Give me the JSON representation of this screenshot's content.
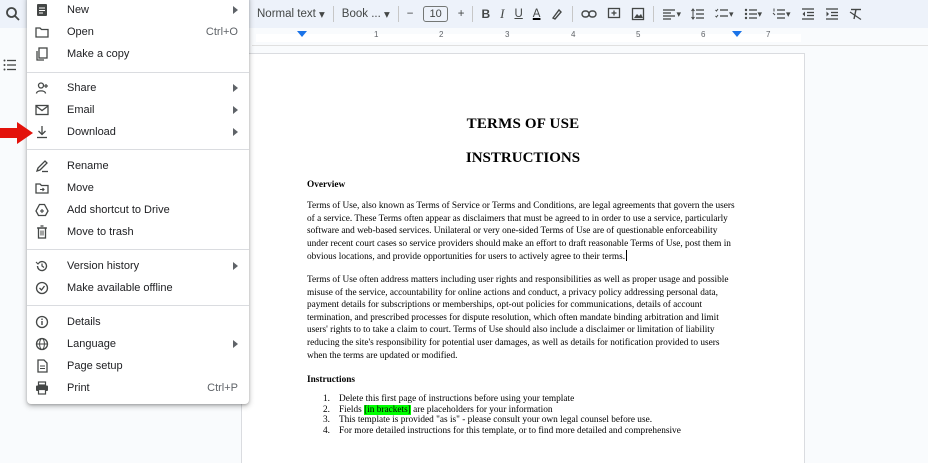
{
  "toolbar": {
    "style": "Normal text",
    "font": "Book ...",
    "minus": "−",
    "size": "10",
    "plus": "+",
    "bold": "B",
    "italic": "I",
    "underline": "U",
    "textcolor": "A"
  },
  "ruler": {
    "numbers": [
      "1",
      "2",
      "3",
      "4",
      "5",
      "6",
      "7"
    ]
  },
  "menu": {
    "new": "New",
    "open": "Open",
    "open_shortcut": "Ctrl+O",
    "copy": "Make a copy",
    "share": "Share",
    "email": "Email",
    "download": "Download",
    "rename": "Rename",
    "move": "Move",
    "shortcut": "Add shortcut to Drive",
    "trash": "Move to trash",
    "version": "Version history",
    "offline": "Make available offline",
    "details": "Details",
    "language": "Language",
    "pagesetup": "Page setup",
    "print": "Print",
    "print_shortcut": "Ctrl+P"
  },
  "doc": {
    "title": "TERMS OF USE",
    "subtitle": "INSTRUCTIONS",
    "overview": "Overview",
    "p1": "Terms of Use, also known as Terms of Service or Terms and Conditions, are legal agreements that govern the users of a service. These Terms often appear as disclaimers that must be agreed to in order to use a service, particularly software and web-based services. Unilateral or very one-sided Terms of Use are of questionable enforceability under recent court cases so service providers should make an effort to draft reasonable Terms of Use, post them in obvious locations, and provide opportunities for users to actively agree to their terms.",
    "p2": "Terms of Use often address matters including user rights and responsibilities as well as proper usage and possible misuse of the service, accountability for online actions and conduct, a privacy policy addressing personal data, payment details for subscriptions or memberships, opt-out policies for communications, details of account termination, and prescribed processes for dispute resolution, which often mandate binding arbitration and limit users' rights to to take a claim to court. Terms of Use should also include a disclaimer or limitation of liability reducing the site's responsibility for potential user damages, as well as details for notification provided to users when the terms are updated or modified.",
    "instructions": "Instructions",
    "list": [
      {
        "n": "1.",
        "pre": "Delete this first page of instructions before using your template",
        "hl": "",
        "post": ""
      },
      {
        "n": "2.",
        "pre": "Fields ",
        "hl": "[in brackets]",
        "post": " are placeholders for your information"
      },
      {
        "n": "3.",
        "pre": "This template is provided \"as is\" - please consult your own legal counsel before use.",
        "hl": "",
        "post": ""
      },
      {
        "n": "4.",
        "pre": "For more detailed instructions for this template, or to find more detailed and comprehensive",
        "hl": "",
        "post": ""
      }
    ]
  }
}
